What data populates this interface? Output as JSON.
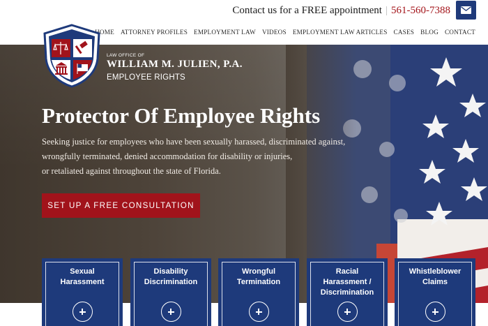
{
  "header": {
    "contact_text": "Contact us for a FREE appointment",
    "separator": "|",
    "phone": "561-560-7388",
    "mail_icon": "envelope-icon"
  },
  "nav": {
    "items": [
      "HOME",
      "ATTORNEY PROFILES",
      "EMPLOYMENT LAW",
      "VIDEOS",
      "EMPLOYMENT LAW ARTICLES",
      "CASES",
      "BLOG",
      "CONTACT"
    ]
  },
  "firm": {
    "pre": "LAW OFFICE OF",
    "name": "WILLIAM M. JULIEN, P.A.",
    "sub": "EMPLOYEE RIGHTS"
  },
  "hero": {
    "title": "Protector Of Employee Rights",
    "lines": [
      "Seeking justice for employees who have been sexually harassed, discriminated against,",
      "wrongfully terminated, denied accommodation for disability or injuries,",
      "or retaliated against throughout the state of Florida."
    ],
    "cta": "SET UP A FREE CONSULTATION"
  },
  "cards": [
    {
      "label": "Sexual Harassment"
    },
    {
      "label": "Disability Discrimination"
    },
    {
      "label": "Wrongful Termination"
    },
    {
      "label": "Racial Harassment / Discrimination"
    },
    {
      "label": "Whistleblower Claims"
    }
  ],
  "colors": {
    "brand_navy": "#1e3a7b",
    "brand_red": "#a1131b",
    "phone_red": "#a3141a"
  }
}
